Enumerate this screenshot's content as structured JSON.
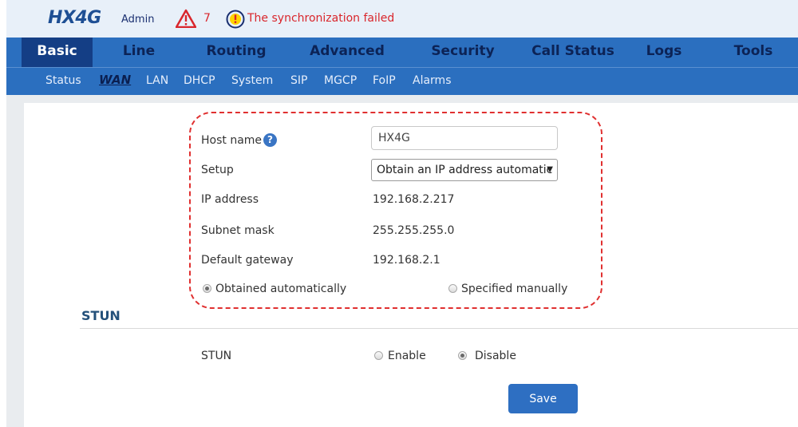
{
  "header": {
    "brand": "HX4G",
    "user": "Admin",
    "alarm_count": "7",
    "sync_message": "The synchronization failed"
  },
  "main_nav": [
    {
      "label": "Basic",
      "active": true
    },
    {
      "label": "Line"
    },
    {
      "label": "Routing"
    },
    {
      "label": "Advanced"
    },
    {
      "label": "Security"
    },
    {
      "label": "Call Status"
    },
    {
      "label": "Logs"
    },
    {
      "label": "Tools"
    }
  ],
  "sub_nav": [
    {
      "label": "Status"
    },
    {
      "label": "WAN",
      "active": true
    },
    {
      "label": "LAN"
    },
    {
      "label": "DHCP"
    },
    {
      "label": "System"
    },
    {
      "label": "SIP"
    },
    {
      "label": "MGCP"
    },
    {
      "label": "FoIP"
    },
    {
      "label": "Alarms"
    }
  ],
  "wan": {
    "host_name_label": "Host name",
    "host_name_value": "HX4G",
    "setup_label": "Setup",
    "setup_value": "Obtain an IP address automatic",
    "ip_label": "IP address",
    "ip_value": "192.168.2.217",
    "mask_label": "Subnet mask",
    "mask_value": "255.255.255.0",
    "gateway_label": "Default gateway",
    "gateway_value": "192.168.2.1",
    "obtained_label": "Obtained automatically",
    "manual_label": "Specified manually"
  },
  "stun": {
    "section_title": "STUN",
    "field_label": "STUN",
    "enable_label": "Enable",
    "disable_label": "Disable"
  },
  "save_label": "Save",
  "colors": {
    "nav_bg": "#2b6fbf",
    "nav_active": "#143e85",
    "alert_red": "#d9262c",
    "highlight_dash": "#e03030"
  }
}
